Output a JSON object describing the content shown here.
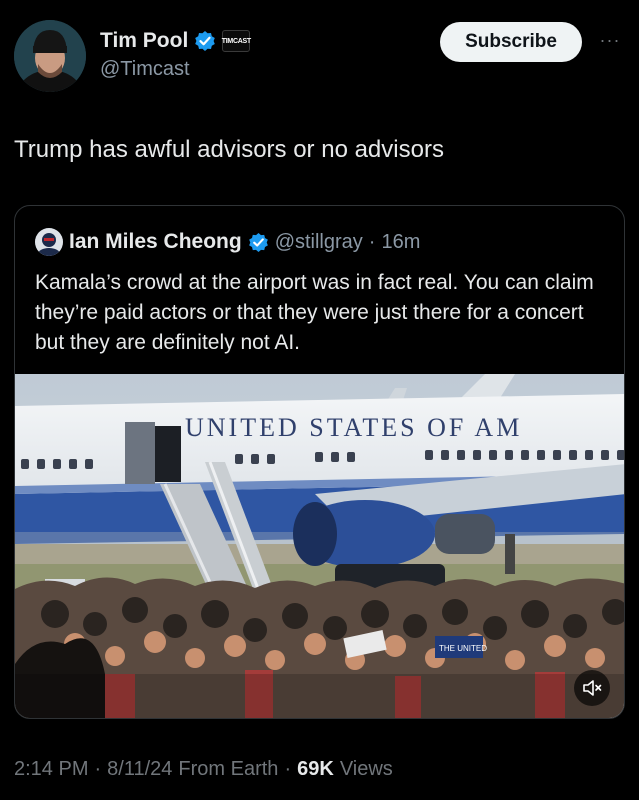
{
  "author": {
    "name": "Tim Pool",
    "handle": "@Timcast",
    "affiliate_badge": "TIMCAST"
  },
  "subscribe_label": "Subscribe",
  "more_label": "···",
  "tweet_text": "Trump has awful advisors or no advisors",
  "quoted": {
    "name": "Ian Miles Cheong",
    "handle": "@stillgray",
    "separator": "·",
    "time": "16m",
    "text": "Kamala’s crowd at the airport was in fact real. You can claim they’re paid actors or that they were just there for a concert but they are definitely not AI."
  },
  "media": {
    "plane_text": "UNITED STATES OF AM",
    "sign_text": "THE UNITED"
  },
  "meta": {
    "time": "2:14 PM",
    "sep1": "·",
    "date": "8/11/24",
    "source": "From Earth",
    "sep2": "·",
    "views_count": "69K",
    "views_label": "Views"
  },
  "colors": {
    "background": "#000000",
    "text": "#e7e9ea",
    "secondary": "#8b98a5",
    "verified_blue": "#1d9bf0",
    "border": "#2f3336"
  },
  "icons": [
    "verified-badge-icon",
    "mute-icon",
    "more-icon"
  ]
}
